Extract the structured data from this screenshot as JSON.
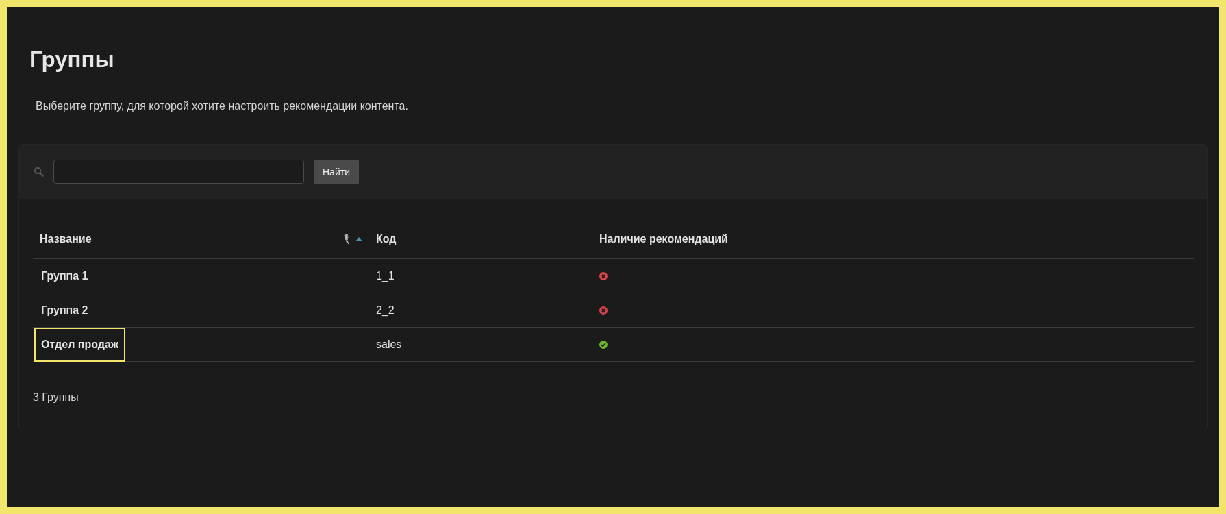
{
  "page": {
    "title": "Группы",
    "subtitle": "Выберите группу, для которой хотите настроить рекомендации контента."
  },
  "search": {
    "button": "Найти"
  },
  "table": {
    "columns": [
      {
        "label": "Название",
        "sorted": true
      },
      {
        "label": "Код",
        "sorted": false
      },
      {
        "label": "Наличие рекомендаций",
        "sorted": false
      }
    ],
    "rows": [
      {
        "name": "Группа 1",
        "code": "1_1",
        "has_recommendations": false,
        "highlighted": false
      },
      {
        "name": "Группа 2",
        "code": "2_2",
        "has_recommendations": false,
        "highlighted": false
      },
      {
        "name": "Отдел продаж",
        "code": "sales",
        "has_recommendations": true,
        "highlighted": true
      }
    ]
  },
  "footer": {
    "count": "3 Группы"
  }
}
